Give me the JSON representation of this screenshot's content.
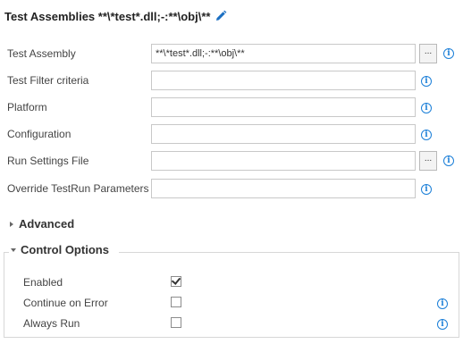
{
  "header": {
    "title": "Test Assemblies **\\*test*.dll;-:**\\obj\\**",
    "edit_icon": "pencil-icon"
  },
  "fields": [
    {
      "label": "Test Assembly",
      "value": "**\\*test*.dll;-:**\\obj\\**",
      "has_browse": true,
      "has_info": true
    },
    {
      "label": "Test Filter criteria",
      "value": "",
      "has_browse": false,
      "has_info": true
    },
    {
      "label": "Platform",
      "value": "",
      "has_browse": false,
      "has_info": true
    },
    {
      "label": "Configuration",
      "value": "",
      "has_browse": false,
      "has_info": true
    },
    {
      "label": "Run Settings File",
      "value": "",
      "has_browse": true,
      "has_info": true
    },
    {
      "label": "Override TestRun Parameters",
      "value": "",
      "has_browse": false,
      "has_info": true
    }
  ],
  "browse_label": "...",
  "info_glyph": "i",
  "advanced": {
    "title": "Advanced",
    "expanded": false
  },
  "control_options": {
    "title": "Control Options",
    "expanded": true,
    "items": [
      {
        "label": "Enabled",
        "checked": true,
        "has_info": false
      },
      {
        "label": "Continue on Error",
        "checked": false,
        "has_info": true
      },
      {
        "label": "Always Run",
        "checked": false,
        "has_info": true
      }
    ]
  },
  "colors": {
    "accent": "#1b7fd8",
    "border": "#c8c8c8"
  }
}
